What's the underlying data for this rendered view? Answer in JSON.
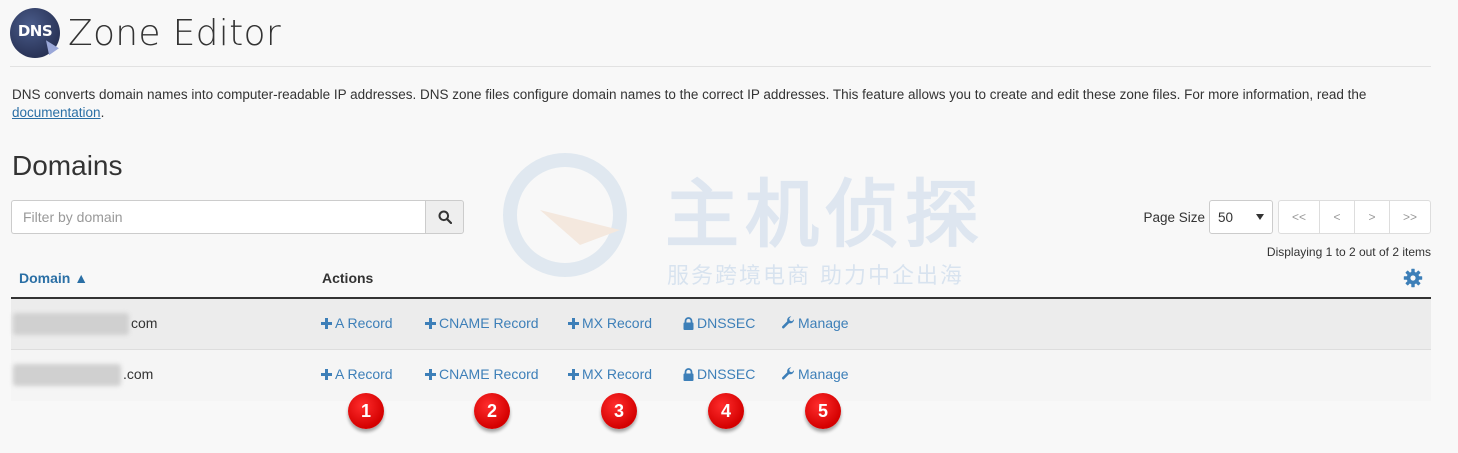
{
  "header": {
    "logo_text": "DNS",
    "title": "Zone Editor"
  },
  "description": {
    "text": "DNS converts domain names into computer-readable IP addresses. DNS zone files configure domain names to the correct IP addresses. This feature allows you to create and edit these zone files. For more information, read the ",
    "link_label": "documentation",
    "suffix": "."
  },
  "section_title": "Domains",
  "search": {
    "placeholder": "Filter by domain",
    "icon": "search-icon"
  },
  "pager": {
    "page_size_label": "Page Size",
    "page_size_value": "50",
    "buttons": [
      "<<",
      "<",
      ">",
      ">>"
    ],
    "displaying": "Displaying 1 to 2 out of 2 items"
  },
  "table": {
    "col_domain": "Domain ▲",
    "col_actions": "Actions",
    "rows": [
      {
        "tld": "com"
      },
      {
        "tld": ".com"
      }
    ],
    "actions": [
      {
        "label": "A Record",
        "icon": "plus-icon"
      },
      {
        "label": "CNAME Record",
        "icon": "plus-icon"
      },
      {
        "label": "MX Record",
        "icon": "plus-icon"
      },
      {
        "label": "DNSSEC",
        "icon": "lock-icon"
      },
      {
        "label": "Manage",
        "icon": "wrench-icon"
      }
    ]
  },
  "badges": [
    "1",
    "2",
    "3",
    "4",
    "5"
  ],
  "watermark": {
    "title": "主机侦探",
    "subtitle": "服务跨境电商 助力中企出海"
  },
  "colors": {
    "link": "#3d7fb8",
    "header_link": "#2a6fa5",
    "badge": "#d40000",
    "logo": "#2a3458"
  }
}
